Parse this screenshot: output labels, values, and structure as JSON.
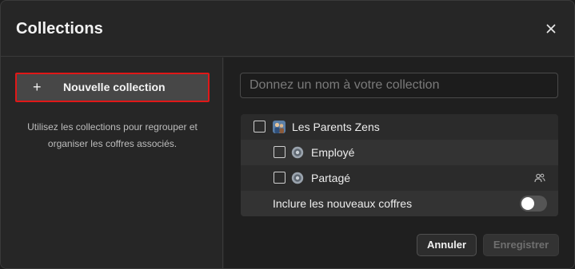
{
  "dialog": {
    "title": "Collections",
    "close_icon": "close-icon"
  },
  "left": {
    "new_button": {
      "icon": "plus-icon",
      "label": "Nouvelle collection"
    },
    "help_text": "Utilisez les collections pour regrouper et organiser les coffres associés."
  },
  "right": {
    "name_input": {
      "placeholder": "Donnez un nom à votre collection",
      "value": ""
    },
    "organization": {
      "label": "Les Parents Zens",
      "checked": false,
      "icon": "organization-avatar-icon"
    },
    "vaults": [
      {
        "label": "Employé",
        "checked": false,
        "icon": "vault-icon",
        "shared": false
      },
      {
        "label": "Partagé",
        "checked": false,
        "icon": "vault-icon",
        "shared": true,
        "shared_icon": "people-icon"
      }
    ],
    "include_new": {
      "label": "Inclure les nouveaux coffres",
      "enabled": false
    }
  },
  "footer": {
    "cancel_label": "Annuler",
    "save_label": "Enregistrer",
    "save_disabled": true
  },
  "colors": {
    "dialog_bg": "#262626",
    "highlight_border": "#e01818",
    "toggle_off": "#555555"
  }
}
